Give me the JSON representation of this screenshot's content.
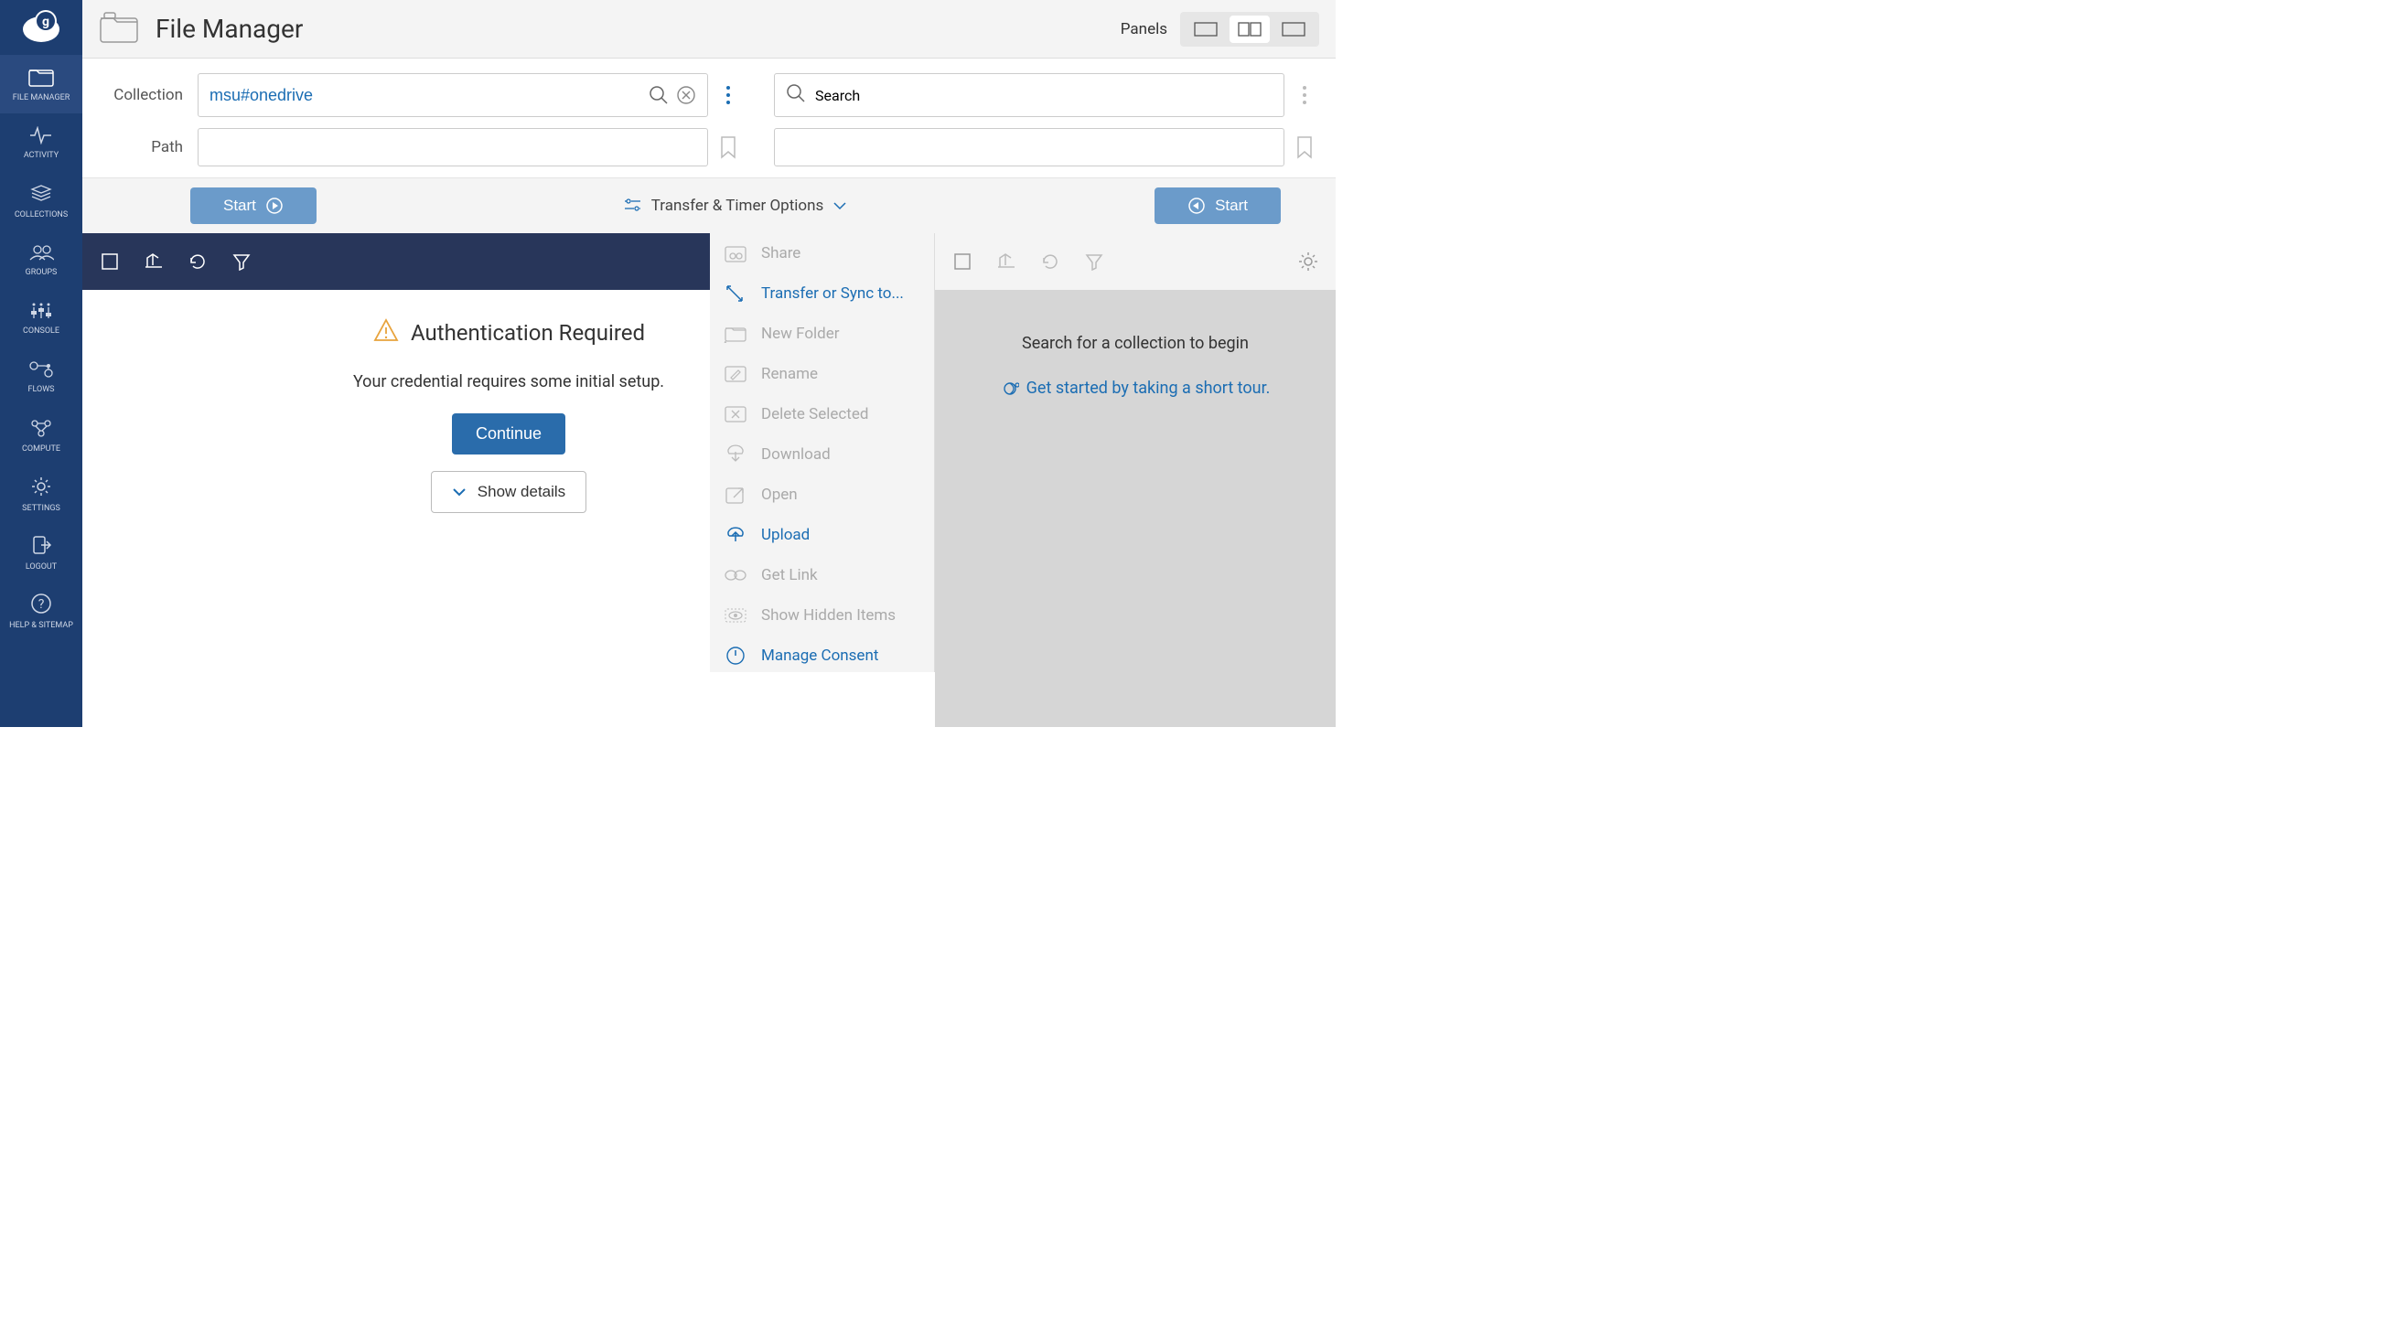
{
  "header": {
    "title": "File Manager",
    "panels_label": "Panels"
  },
  "sidebar": {
    "items": [
      "FILE MANAGER",
      "ACTIVITY",
      "COLLECTIONS",
      "GROUPS",
      "CONSOLE",
      "FLOWS",
      "COMPUTE",
      "SETTINGS",
      "LOGOUT",
      "HELP & SITEMAP"
    ]
  },
  "left_panel": {
    "collection_label": "Collection",
    "collection_value": "msu#onedrive",
    "path_label": "Path",
    "path_value": "",
    "start_label": "Start",
    "auth": {
      "title": "Authentication Required",
      "message": "Your credential requires some initial setup.",
      "continue": "Continue",
      "show_details": "Show details"
    }
  },
  "transfer_options": "Transfer & Timer Options",
  "right_panel": {
    "search_placeholder": "Search",
    "start_label": "Start",
    "empty_message": "Search for a collection to begin",
    "tour": "Get started by taking a short tour."
  },
  "dropdown": {
    "items": [
      {
        "label": "Share",
        "enabled": false
      },
      {
        "label": "Transfer or Sync to...",
        "enabled": true
      },
      {
        "label": "New Folder",
        "enabled": false
      },
      {
        "label": "Rename",
        "enabled": false
      },
      {
        "label": "Delete Selected",
        "enabled": false
      },
      {
        "label": "Download",
        "enabled": false
      },
      {
        "label": "Open",
        "enabled": false
      },
      {
        "label": "Upload",
        "enabled": true
      },
      {
        "label": "Get Link",
        "enabled": false
      },
      {
        "label": "Show Hidden Items",
        "enabled": false
      },
      {
        "label": "Manage Consent",
        "enabled": true
      }
    ]
  }
}
